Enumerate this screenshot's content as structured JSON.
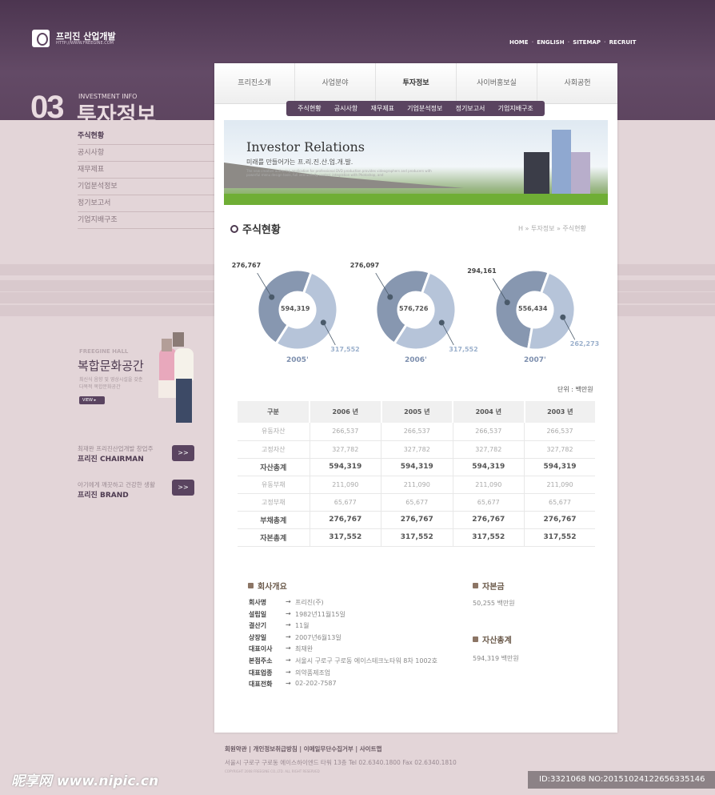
{
  "header": {
    "logo_title": "프리진 산업개발",
    "logo_url": "HTTP://WWW.FREEGINE.COM",
    "links": [
      "HOME",
      "ENGLISH",
      "SITEMAP",
      "RECRUIT"
    ]
  },
  "section": {
    "number": "03",
    "en": "INVESTMENT INFO",
    "ko": "투자정보"
  },
  "gnb": [
    "프리진소개",
    "사업분야",
    "투자정보",
    "사이버홍보실",
    "사회공헌"
  ],
  "snb": [
    "주식현황",
    "공시사항",
    "재무제표",
    "기업분석정보",
    "정기보고서",
    "기업지배구조"
  ],
  "lnb": [
    "주식현황",
    "공시사항",
    "재무제표",
    "기업분석정보",
    "정기보고서",
    "기업지배구조"
  ],
  "promo": {
    "hall_en": "FREEGINE HALL",
    "hall_title": "복합문화공간",
    "hall_desc1": "최신식 음향 및 영상시설을 갖춘",
    "hall_desc2": "다목적 복합문화공간",
    "view": "VIEW",
    "chair_sub": "최재완 프리진산업개발 창업주",
    "chair_title": "프리진 CHAIRMAN",
    "brand_sub": "아기에게 깨끗하고 건강한 생활",
    "brand_title": "프리진 BRAND",
    "more": ">>"
  },
  "banner": {
    "title": "Investor Relations",
    "subtitle": "미래를 만들어가는 프.리.진.산.업.개.발.",
    "small": "The new creative authoring application for professional DVD production provides videographers and producers with powerful menu design tools, full interactivity control, integration with Photoshop, and"
  },
  "page": {
    "title": "주식현황",
    "breadcrumb": "H » 투자정보 » 주식현황"
  },
  "chart_data": [
    {
      "type": "pie",
      "title": "2005'",
      "center_label": "594,319",
      "slices": [
        {
          "label": "276,767",
          "value": 276767,
          "color": "#8797b0"
        },
        {
          "label": "317,552",
          "value": 317552,
          "color": "#b6c4d9"
        }
      ]
    },
    {
      "type": "pie",
      "title": "2006'",
      "center_label": "576,726",
      "slices": [
        {
          "label": "276,097",
          "value": 276097,
          "color": "#8797b0"
        },
        {
          "label": "317,552",
          "value": 317552,
          "color": "#b6c4d9"
        }
      ]
    },
    {
      "type": "pie",
      "title": "2007'",
      "center_label": "556,434",
      "slices": [
        {
          "label": "294,161",
          "value": 294161,
          "color": "#8797b0"
        },
        {
          "label": "262,273",
          "value": 262273,
          "color": "#b6c4d9"
        }
      ]
    }
  ],
  "unit": "단위 : 백만원",
  "table": {
    "headers": [
      "구분",
      "2006 년",
      "2005 년",
      "2004 년",
      "2003 년"
    ],
    "rows": [
      [
        "유동자산",
        "266,537",
        "266,537",
        "266,537",
        "266,537"
      ],
      [
        "고정자산",
        "327,782",
        "327,782",
        "327,782",
        "327,782"
      ],
      [
        "자산총계",
        "594,319",
        "594,319",
        "594,319",
        "594,319"
      ],
      [
        "유동부채",
        "211,090",
        "211,090",
        "211,090",
        "211,090"
      ],
      [
        "고정부채",
        "65,677",
        "65,677",
        "65,677",
        "65,677"
      ],
      [
        "부채총계",
        "276,767",
        "276,767",
        "276,767",
        "276,767"
      ],
      [
        "자본총계",
        "317,552",
        "317,552",
        "317,552",
        "317,552"
      ]
    ],
    "bold_rows": [
      2,
      5,
      6
    ]
  },
  "company": {
    "title": "회사개요",
    "arrow": "→",
    "items": [
      [
        "회사명",
        "프리진(주)"
      ],
      [
        "설립일",
        "1982년11월15일"
      ],
      [
        "결산기",
        "11월"
      ],
      [
        "상장일",
        "2007년6월13일"
      ],
      [
        "대표이사",
        "최재완"
      ],
      [
        "본점주소",
        "서울시 구로구 구로동 에이스테크노타워 8차 1002호"
      ],
      [
        "대표업종",
        "의약품제조업"
      ],
      [
        "대표전화",
        "02-202-7587"
      ]
    ]
  },
  "capital": {
    "title": "자본금",
    "value": "50,255 백만원"
  },
  "assets": {
    "title": "자산총계",
    "value": "594,319 백만원"
  },
  "footer": {
    "links": "회원약관 | 개인정보취급방침 | 이메일무단수집거부 | 사이트맵",
    "address": "서울시 구로구 구로동 에이스하이엔드 타워 13층    Tel 02.6340.1800    Fax 02.6340.1810",
    "copyright": "COPYRIGHT 2008 FREEGINE CO.,LTD. ALL RIGHT RESERVED"
  },
  "watermark": {
    "left": "昵享网 www.nipic.cn",
    "right": "ID:3321068 NO:20151024122656335146"
  }
}
